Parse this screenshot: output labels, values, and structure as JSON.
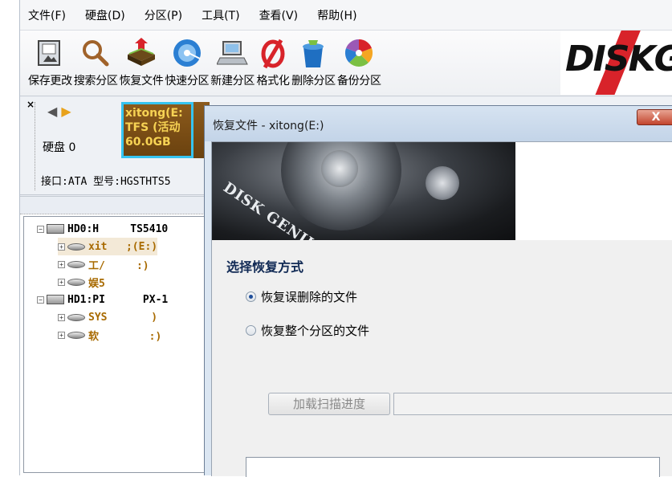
{
  "menu": [
    "文件(F)",
    "硬盘(D)",
    "分区(P)",
    "工具(T)",
    "查看(V)",
    "帮助(H)"
  ],
  "toolbar": [
    {
      "label": "保存更改",
      "icon": "save-changes-icon"
    },
    {
      "label": "搜索分区",
      "icon": "search-partition-icon"
    },
    {
      "label": "恢复文件",
      "icon": "recover-files-icon"
    },
    {
      "label": "快速分区",
      "icon": "quick-partition-icon"
    },
    {
      "label": "新建分区",
      "icon": "new-partition-icon"
    },
    {
      "label": "格式化",
      "icon": "format-icon"
    },
    {
      "label": "删除分区",
      "icon": "delete-partition-icon"
    },
    {
      "label": "备份分区",
      "icon": "backup-partition-icon"
    }
  ],
  "brand": {
    "text": "DISKG"
  },
  "disk_panel": {
    "close": "×",
    "prev": "◀",
    "next": "▶",
    "disk_label": "硬盘 0",
    "interface": "接口:ATA  型号:HGSTHTS5",
    "partition": {
      "name": "xitong(E:",
      "fs": "TFS (活动",
      "size": "60.0GB"
    }
  },
  "tree": [
    {
      "label": "HD0:H     TS5410",
      "level": 0,
      "type": "disk"
    },
    {
      "label": "xit   ;(E:)",
      "level": 1,
      "type": "volume",
      "selected": true
    },
    {
      "label": "工/     :)",
      "level": 1,
      "type": "volume"
    },
    {
      "label": "娱5",
      "level": 1,
      "type": "volume"
    },
    {
      "label": "HD1:PI      PX-1",
      "level": 0,
      "type": "disk"
    },
    {
      "label": "SYS       )",
      "level": 1,
      "type": "volume"
    },
    {
      "label": "软        :)",
      "level": 1,
      "type": "volume"
    }
  ],
  "dialog": {
    "title": "恢复文件 - xitong(E:)",
    "close": "X",
    "banner_text": "DISK GENIUS",
    "section_title": "选择恢复方式",
    "options": [
      {
        "label": "恢复误删除的文件",
        "checked": true
      },
      {
        "label": "恢复整个分区的文件",
        "checked": false
      }
    ],
    "load_button": "加载扫描进度"
  }
}
